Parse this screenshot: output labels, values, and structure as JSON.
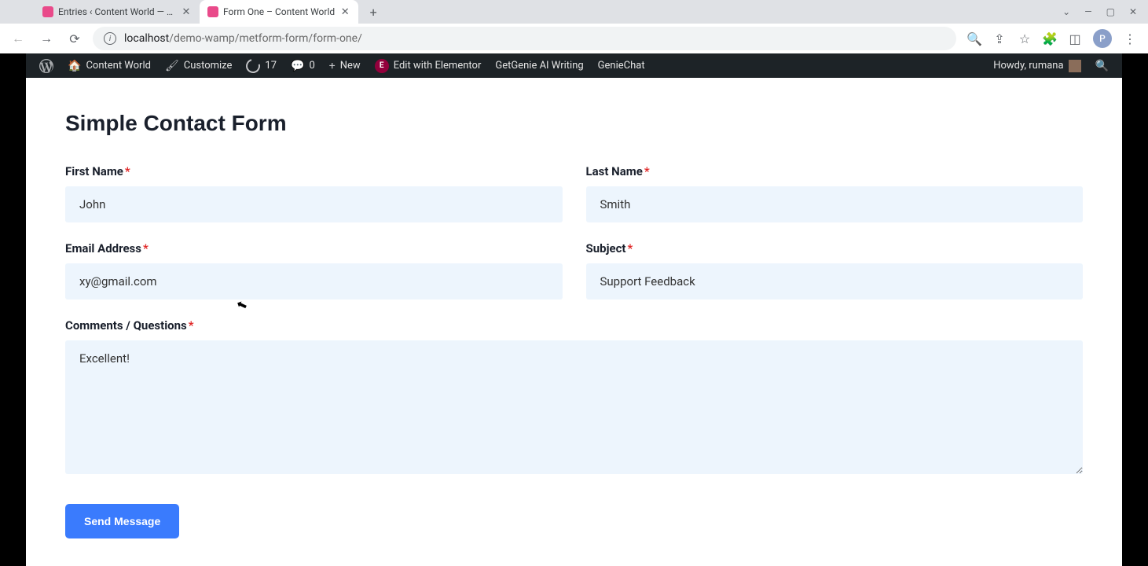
{
  "browser": {
    "tabs": [
      {
        "title": "Entries ‹ Content World — WordPress",
        "active": false
      },
      {
        "title": "Form One – Content World",
        "active": true
      }
    ],
    "url_host": "localhost",
    "url_path": "/demo-wamp/metform-form/form-one/",
    "profile_letter": "P"
  },
  "wpbar": {
    "site_name": "Content World",
    "customize": "Customize",
    "updates_count": "17",
    "comments_count": "0",
    "new_label": "New",
    "edit_elementor": "Edit with Elementor",
    "getgenie": "GetGenie AI Writing",
    "geniechat": "GenieChat",
    "greeting": "Howdy, rumana"
  },
  "form": {
    "title": "Simple Contact Form",
    "first_name_label": "First Name",
    "first_name_value": "John",
    "last_name_label": "Last Name",
    "last_name_value": "Smith",
    "email_label": "Email Address",
    "email_value": "xy@gmail.com",
    "subject_label": "Subject",
    "subject_value": "Support Feedback",
    "comments_label": "Comments / Questions",
    "comments_value": "Excellent!",
    "submit_label": "Send Message"
  }
}
